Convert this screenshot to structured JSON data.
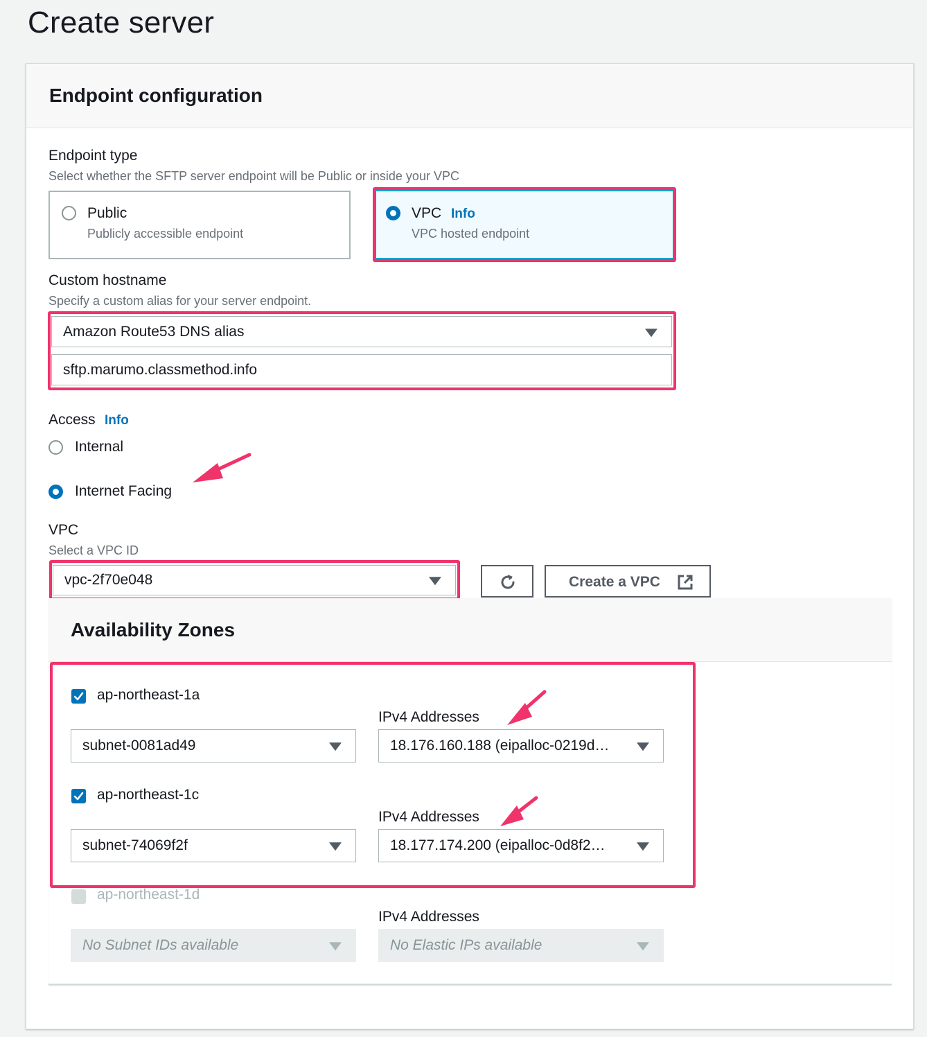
{
  "page": {
    "title": "Create server"
  },
  "endpoint": {
    "section_title": "Endpoint configuration",
    "type_label": "Endpoint type",
    "type_desc": "Select whether the SFTP server endpoint will be Public or inside your VPC",
    "public_label": "Public",
    "public_desc": "Publicly accessible endpoint",
    "vpc_label": "VPC",
    "vpc_info": "Info",
    "vpc_desc": "VPC hosted endpoint"
  },
  "hostname": {
    "label": "Custom hostname",
    "desc": "Specify a custom alias for your server endpoint.",
    "selected": "Amazon Route53 DNS alias",
    "value": "sftp.marumo.classmethod.info"
  },
  "access": {
    "label": "Access",
    "info": "Info",
    "internal": "Internal",
    "internet_facing": "Internet Facing"
  },
  "vpc": {
    "label": "VPC",
    "desc": "Select a VPC ID",
    "selected": "vpc-2f70e048",
    "create_label": "Create a VPC"
  },
  "az": {
    "title": "Availability Zones",
    "ipv4_label": "IPv4 Addresses",
    "zones": [
      {
        "name": "ap-northeast-1a",
        "subnet": "subnet-0081ad49",
        "ip": "18.176.160.188 (eipalloc-0219d…"
      },
      {
        "name": "ap-northeast-1c",
        "subnet": "subnet-74069f2f",
        "ip": "18.177.174.200 (eipalloc-0d8f2…"
      },
      {
        "name": "ap-northeast-1d",
        "subnet": "No Subnet IDs available",
        "ip": "No Elastic IPs available"
      }
    ]
  },
  "colors": {
    "accent": "#0073bb",
    "highlight": "#f0336b"
  },
  "icons": {
    "refresh": "refresh-icon",
    "external": "external-link-icon",
    "caret": "caret-down-icon",
    "check": "check-icon"
  }
}
